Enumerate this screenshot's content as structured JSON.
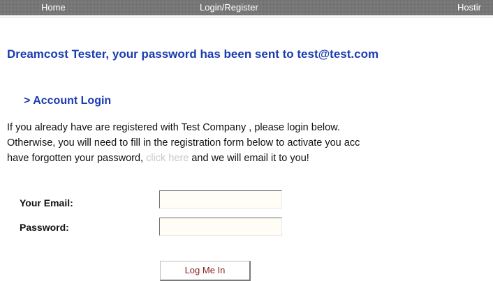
{
  "nav": {
    "items": [
      {
        "label": "Home"
      },
      {
        "label": "Login/Register"
      },
      {
        "label": "Hostir"
      }
    ]
  },
  "confirmation": {
    "message": "Dreamcost Tester, your password has been sent to test@test.com"
  },
  "account_login": {
    "title": "> Account Login",
    "intro_line1": "If you already have are registered with Test Company , please login below.",
    "intro_line2": "Otherwise, you will need to fill in the registration form below to activate you acc",
    "intro_line3_before": "have forgotten your password, ",
    "intro_link": "click here",
    "intro_line3_after": " and we will email it to you!"
  },
  "form": {
    "email_label": "Your Email:",
    "email_value": "",
    "password_label": "Password:",
    "password_value": "",
    "submit_label": "Log Me In"
  },
  "colors": {
    "heading_blue": "#1a3cb0",
    "nav_gray": "#6f6f6f",
    "link_gray": "#c8c8c8",
    "button_text": "#8a1a1a"
  }
}
